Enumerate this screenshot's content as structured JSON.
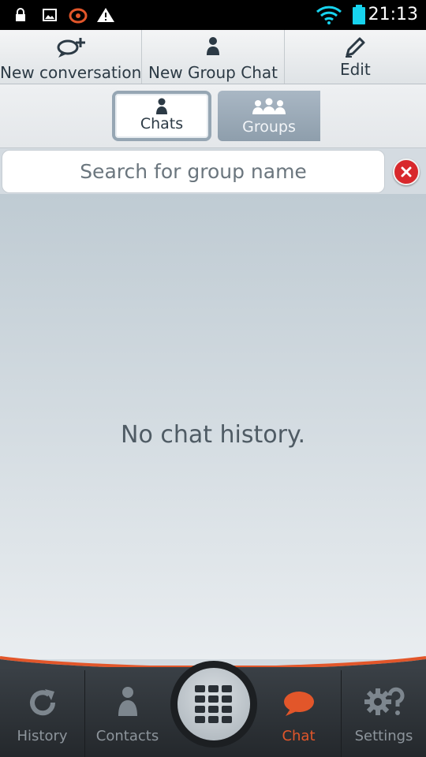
{
  "status_bar": {
    "time": "21:13",
    "icons": [
      "lock-icon",
      "image-icon",
      "app-icon",
      "warning-icon",
      "wifi-icon",
      "battery-icon"
    ]
  },
  "toolbar": {
    "new_conversation": "New conversation",
    "new_group_chat": "New Group Chat",
    "edit": "Edit"
  },
  "segments": {
    "chats": "Chats",
    "groups": "Groups",
    "selected": "Chats"
  },
  "search": {
    "placeholder": "Search for group name",
    "value": ""
  },
  "empty_message": "No chat history.",
  "bottom_nav": {
    "history": "History",
    "contacts": "Contacts",
    "chat": "Chat",
    "settings": "Settings",
    "active": "Chat"
  },
  "colors": {
    "accent": "#e2562a",
    "clear_button": "#d8282c",
    "nav_background": "#2e3338"
  }
}
